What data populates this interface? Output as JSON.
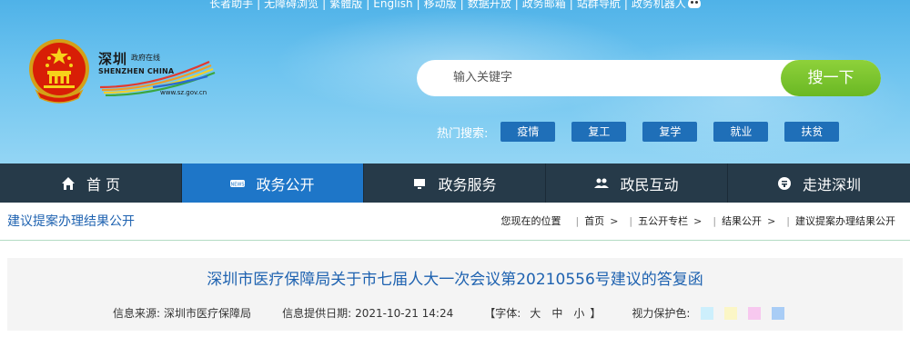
{
  "toplinks": [
    "长者助手",
    "无障碍浏览",
    "繁體版",
    "English",
    "移动版",
    "数据开放",
    "政务邮箱",
    "站群导航",
    "政务机器人"
  ],
  "logo": {
    "cn": "深圳",
    "small": "政府在线",
    "en": "SHENZHEN CHINA",
    "url": "www.sz.gov.cn"
  },
  "search": {
    "placeholder": "输入关键字",
    "button": "搜一下"
  },
  "hot": {
    "label": "热门搜索:",
    "tags": [
      "疫情",
      "复工",
      "复学",
      "就业",
      "扶贫"
    ]
  },
  "nav": [
    {
      "label": "首 页",
      "icon": "home-icon",
      "active": false
    },
    {
      "label": "政务公开",
      "icon": "news-icon",
      "active": true
    },
    {
      "label": "政务服务",
      "icon": "monitor-icon",
      "active": false
    },
    {
      "label": "政民互动",
      "icon": "people-icon",
      "active": false
    },
    {
      "label": "走进深圳",
      "icon": "info-icon",
      "active": false
    }
  ],
  "section_title": "建议提案办理结果公开",
  "breadcrumb": {
    "prefix": "您现在的位置",
    "items": [
      "首页",
      "五公开专栏",
      "结果公开",
      "建议提案办理结果公开"
    ]
  },
  "article": {
    "title": "深圳市医疗保障局关于市七届人大一次会议第20210556号建议的答复函",
    "source_label": "信息来源:",
    "source": "深圳市医疗保障局",
    "date_label": "信息提供日期:",
    "date": "2021-10-21 14:24",
    "font_label": "【字体:",
    "font_sizes": [
      "大",
      "中",
      "小"
    ],
    "font_end": "】",
    "eye_label": "视力保护色:",
    "eye_colors": [
      "#cdeffc",
      "#fbf6c6",
      "#f7c8ef",
      "#a9cdf6"
    ]
  }
}
